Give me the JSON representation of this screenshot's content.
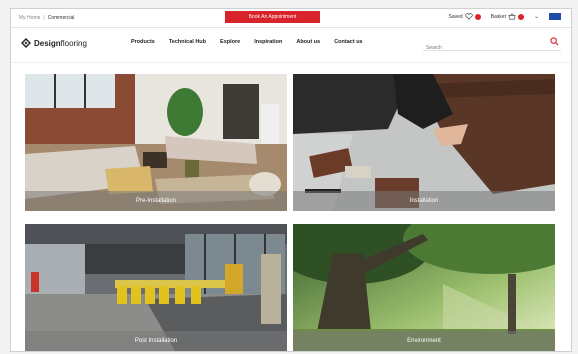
{
  "breadcrumb": {
    "home": "My Home",
    "separator": "|",
    "current": "Commercial"
  },
  "topbar": {
    "book_button": "Book An Appointment",
    "saved_label": "Saved",
    "basket_label": "Basket"
  },
  "logo": {
    "bold": "Design",
    "light": "flooring"
  },
  "nav": {
    "items": [
      "Products",
      "Technical Hub",
      "Explore",
      "Inspiration",
      "About us",
      "Contact us"
    ]
  },
  "search": {
    "placeholder": "Search"
  },
  "tiles": [
    {
      "label": "Pre-Installation"
    },
    {
      "label": "Installation"
    },
    {
      "label": "Post Installation"
    },
    {
      "label": "Environment"
    }
  ],
  "colors": {
    "accent": "#d8232a",
    "flag": "#1f4ea8"
  },
  "icons": [
    "heart-icon",
    "basket-icon",
    "chevron-down-icon",
    "flag-icon",
    "search-icon",
    "logo-icon"
  ]
}
